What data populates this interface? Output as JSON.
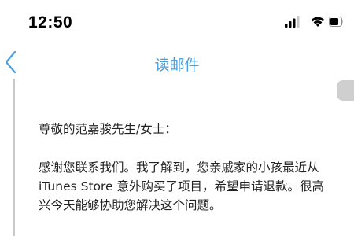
{
  "status_bar": {
    "time": "12:50"
  },
  "icons": {
    "signal": "cellular-signal-icon",
    "wifi": "wifi-icon",
    "battery": "battery-icon",
    "back": "chevron-left-icon"
  },
  "nav": {
    "title": "读邮件"
  },
  "email": {
    "greeting": "尊敬的范嘉骏先生/女士：",
    "body_lines": [
      "感谢您联系我们。我了解到，您亲戚家的小孩最近从",
      "iTunes Store 意外购买了项目，希望申请退款。很高",
      "兴今天能够协助您解决这个问题。"
    ]
  },
  "colors": {
    "accent": "#4a9fe0",
    "text": "#222222",
    "rule": "#c9c9c9"
  }
}
